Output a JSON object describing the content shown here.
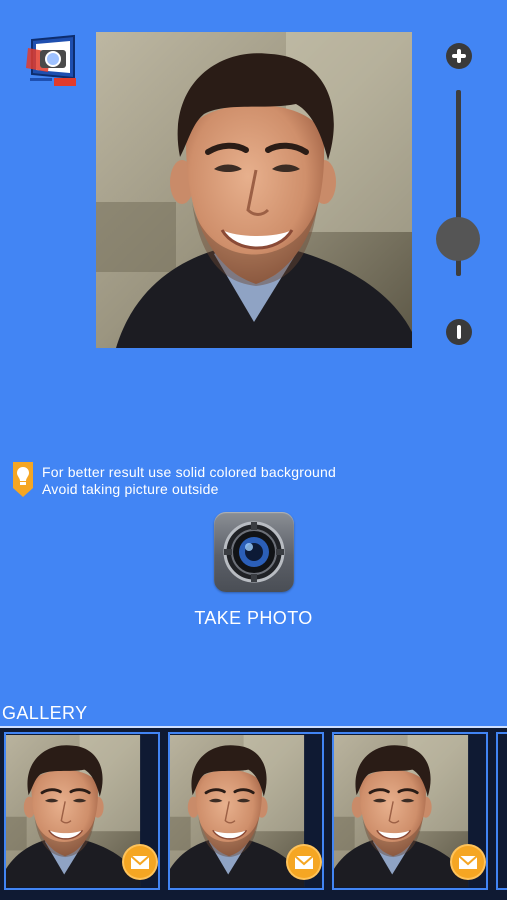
{
  "app": {
    "logo_icon": "camera-frame-logo-icon"
  },
  "preview": {
    "image_subject": "smiling-man-portrait"
  },
  "zoom": {
    "zoom_in_icon": "plus-circle-icon",
    "zoom_out_icon": "minus-circle-icon",
    "level": 0.2
  },
  "tips": {
    "icon": "lightbulb-icon",
    "line1": "For better result use solid colored background",
    "line2": "Avoid taking picture outside"
  },
  "camera": {
    "icon": "camera-lens-icon",
    "label": "TAKE PHOTO"
  },
  "gallery": {
    "title": "GALLERY",
    "items": [
      {
        "subject": "smiling-man-portrait",
        "action_icon": "mail-icon"
      },
      {
        "subject": "smiling-man-portrait",
        "action_icon": "mail-icon"
      },
      {
        "subject": "smiling-man-portrait",
        "action_icon": "mail-icon"
      }
    ]
  },
  "colors": {
    "background": "#4285f4",
    "badge": "#f5a623",
    "tip_icon": "#f5a623",
    "slider": "#3d3d3d"
  }
}
